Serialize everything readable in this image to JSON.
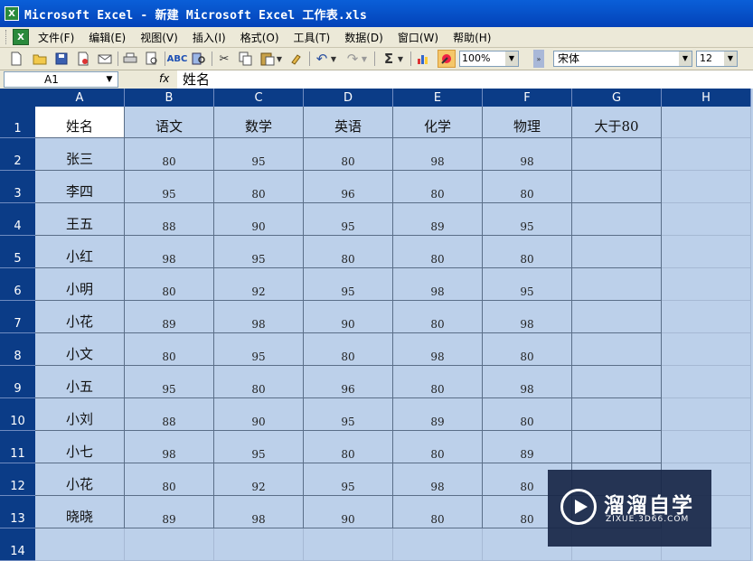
{
  "window": {
    "title": "Microsoft Excel - 新建 Microsoft Excel 工作表.xls",
    "app_icon": "excel-icon"
  },
  "menu": {
    "items": [
      "文件(F)",
      "编辑(E)",
      "视图(V)",
      "插入(I)",
      "格式(O)",
      "工具(T)",
      "数据(D)",
      "窗口(W)",
      "帮助(H)"
    ]
  },
  "toolbar": {
    "zoom": "100%",
    "font": "宋体",
    "font_size": "12"
  },
  "formula_bar": {
    "cell_ref": "A1",
    "fx": "fx",
    "content": "姓名"
  },
  "sheet": {
    "columns": [
      "A",
      "B",
      "C",
      "D",
      "E",
      "F",
      "G",
      "H"
    ],
    "rows": [
      "1",
      "2",
      "3",
      "4",
      "5",
      "6",
      "7",
      "8",
      "9",
      "10",
      "11",
      "12",
      "13",
      "14"
    ],
    "cells": [
      [
        "姓名",
        "语文",
        "数学",
        "英语",
        "化学",
        "物理",
        "大于80"
      ],
      [
        "张三",
        "80",
        "95",
        "80",
        "98",
        "98",
        ""
      ],
      [
        "李四",
        "95",
        "80",
        "96",
        "80",
        "80",
        ""
      ],
      [
        "王五",
        "88",
        "90",
        "95",
        "89",
        "95",
        ""
      ],
      [
        "小红",
        "98",
        "95",
        "80",
        "80",
        "80",
        ""
      ],
      [
        "小明",
        "80",
        "92",
        "95",
        "98",
        "95",
        ""
      ],
      [
        "小花",
        "89",
        "98",
        "90",
        "80",
        "98",
        ""
      ],
      [
        "小文",
        "80",
        "95",
        "80",
        "98",
        "80",
        ""
      ],
      [
        "小五",
        "95",
        "80",
        "96",
        "80",
        "98",
        ""
      ],
      [
        "小刘",
        "88",
        "90",
        "95",
        "89",
        "80",
        ""
      ],
      [
        "小七",
        "98",
        "95",
        "80",
        "80",
        "89",
        ""
      ],
      [
        "小花",
        "80",
        "92",
        "95",
        "98",
        "80",
        ""
      ],
      [
        "晓晓",
        "89",
        "98",
        "90",
        "80",
        "80",
        ""
      ]
    ],
    "active_cell": "A1",
    "colors": {
      "header_bg": "#0b3c87",
      "sheet_bg": "#bcd0ea",
      "active_bg": "#ffffff"
    }
  },
  "watermark": {
    "brand": "溜溜自学",
    "url": "ZIXUE.3D66.COM"
  }
}
